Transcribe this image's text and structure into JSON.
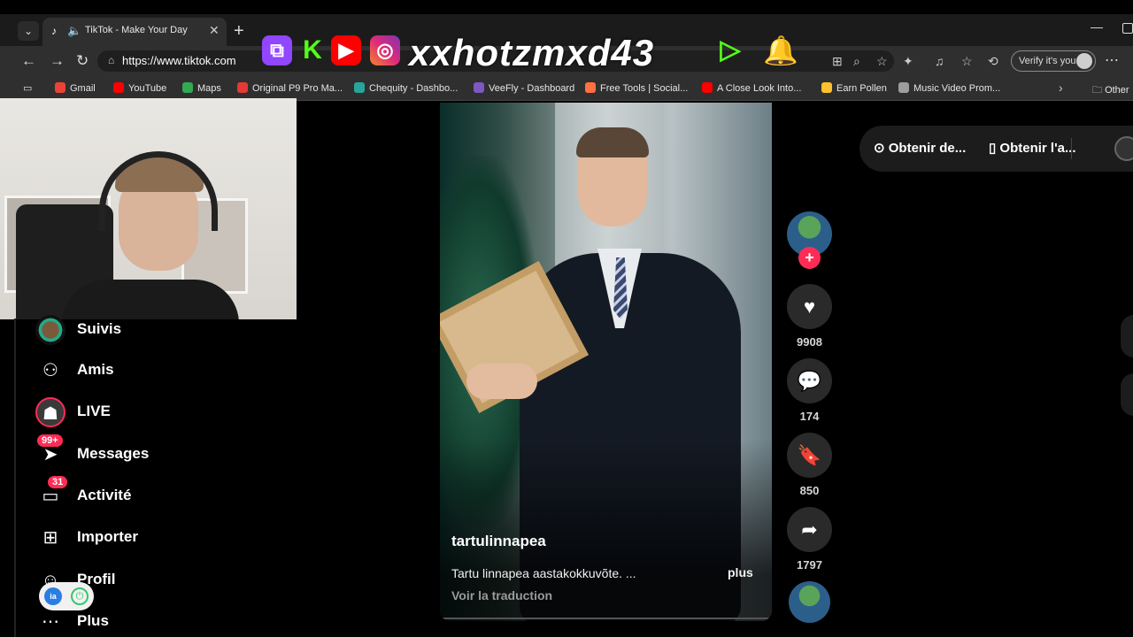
{
  "browser": {
    "tab_title": "TikTok - Make Your Day",
    "url": "https://www.tiktok.com",
    "verify_label": "Verify it's you",
    "bookmarks": [
      {
        "label": "Gmail",
        "color": "#ea4335"
      },
      {
        "label": "YouTube",
        "color": "#ff0000"
      },
      {
        "label": "Maps",
        "color": "#34a853"
      },
      {
        "label": "Original P9 Pro Ma...",
        "color": "#e53935"
      },
      {
        "label": "Chequity - Dashbo...",
        "color": "#26a69a"
      },
      {
        "label": "VeeFly - Dashboard",
        "color": "#7e57c2"
      },
      {
        "label": "Free Tools | Social...",
        "color": "#ff7043"
      },
      {
        "label": "A Close Look Into...",
        "color": "#ff0000"
      },
      {
        "label": "Earn Pollen",
        "color": "#fbc02d"
      },
      {
        "label": "Music Video Prom...",
        "color": "#9e9e9e"
      }
    ],
    "other_bookmarks": "Other"
  },
  "overlay": {
    "handle": "xxhotzmxd43"
  },
  "sidebar": {
    "items": [
      {
        "label": "Suivis",
        "icon": "avatar"
      },
      {
        "label": "Amis",
        "icon": "friends-icon"
      },
      {
        "label": "LIVE",
        "icon": "live-icon"
      },
      {
        "label": "Messages",
        "icon": "inbox-icon",
        "badge": "99+"
      },
      {
        "label": "Activité",
        "icon": "activity-icon",
        "badge": "31"
      },
      {
        "label": "Importer",
        "icon": "upload-icon"
      },
      {
        "label": "Profil",
        "icon": "profile-icon"
      },
      {
        "label": "Plus",
        "icon": "more-icon"
      }
    ]
  },
  "video": {
    "username": "tartulinnapea",
    "description": "Tartu linnapea aastakokkuvõte. ...",
    "more_label": "plus",
    "translate_label": "Voir la traduction"
  },
  "actions": {
    "likes": "9908",
    "comments": "174",
    "saves": "850",
    "shares": "1797"
  },
  "top_right": {
    "get_desktop": "Obtenir de...",
    "get_app": "Obtenir l'a..."
  },
  "colors": {
    "accent": "#fe2c55",
    "background": "#000000"
  }
}
